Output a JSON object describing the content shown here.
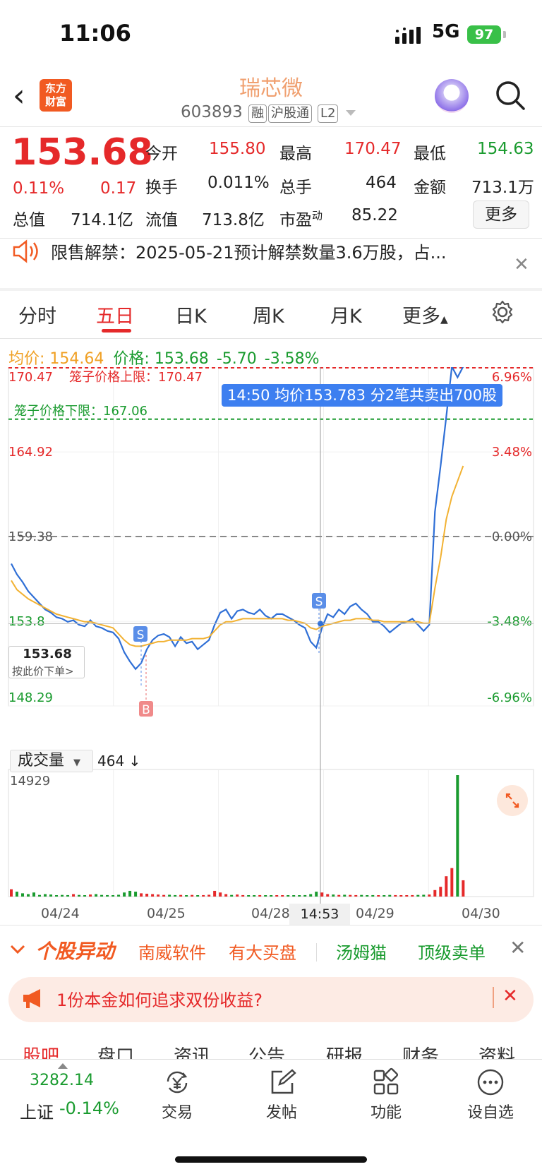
{
  "status_bar": {
    "time": "11:06",
    "network": "5G",
    "battery": "97"
  },
  "header": {
    "logo_line1": "东方",
    "logo_line2": "财富",
    "stock_name": "瑞芯微",
    "stock_code": "603893",
    "tags": [
      "融",
      "沪股通",
      "L2"
    ]
  },
  "quote": {
    "price": "153.68",
    "change_pct": "0.11%",
    "change": "0.17",
    "fields": {
      "open_label": "今开",
      "open": "155.80",
      "high_label": "最高",
      "high": "170.47",
      "low_label": "最低",
      "low": "154.63",
      "turnover_label": "换手",
      "turnover": "0.011%",
      "volume_label": "总手",
      "volume": "464",
      "amount_label": "金额",
      "amount": "713.1万",
      "mcap_label": "总值",
      "mcap": "714.1亿",
      "float_label": "流值",
      "float": "713.8亿",
      "pe_label": "市盈",
      "pe_sup": "动",
      "pe": "85.22"
    },
    "more_label": "更多"
  },
  "notice": {
    "text": "限售解禁：2025-05-21预计解禁数量3.6万股，占..."
  },
  "tabs": [
    {
      "label": "分时",
      "active": false
    },
    {
      "label": "五日",
      "active": true
    },
    {
      "label": "日K",
      "active": false
    },
    {
      "label": "周K",
      "active": false
    },
    {
      "label": "月K",
      "active": false
    },
    {
      "label": "更多",
      "active": false
    }
  ],
  "legend": {
    "avg_label": "均价:",
    "avg_value": "154.64",
    "price_label": "价格:",
    "price_value": "153.68",
    "change": "-5.70",
    "change_pct": "-3.58%"
  },
  "chart_overlay": {
    "upper_limit_text": "笼子价格上限：170.47",
    "lower_limit_text": "笼子价格下限：167.06",
    "bubble": "14:50 均价153.783  分2笔共卖出700股",
    "price_box_value": "153.68",
    "price_box_hint": "按此价下单>",
    "marker_s": "S",
    "marker_b": "B"
  },
  "volume": {
    "selector_label": "成交量",
    "value": "464 ↓",
    "max_label": "14929"
  },
  "crosshair_time": "14:53",
  "chart_data": {
    "type": "line",
    "title": "",
    "x_labels": [
      "04/24",
      "04/25",
      "04/28",
      "04/29",
      "04/30"
    ],
    "y_left_ticks": [
      "170.47",
      "164.92",
      "159.38",
      "153.8",
      "148.29"
    ],
    "y_right_ticks": [
      "6.96%",
      "3.48%",
      "0.00%",
      "-3.48%",
      "-6.96%"
    ],
    "ylim": [
      148.29,
      170.47
    ],
    "prev_close": 159.38,
    "upper_limit": 170.47,
    "lower_limit": 167.06,
    "series": [
      {
        "name": "价格",
        "color": "#2f6fd6",
        "values": [
          157.6,
          156.9,
          156.4,
          155.8,
          155.4,
          155.0,
          154.6,
          154.4,
          154.1,
          154.0,
          153.8,
          153.9,
          153.6,
          153.5,
          153.9,
          153.5,
          153.4,
          153.2,
          153.1,
          152.7,
          151.8,
          151.2,
          150.7,
          151.1,
          152.0,
          152.6,
          152.9,
          153.0,
          152.8,
          152.2,
          152.8,
          152.4,
          152.5,
          152.0,
          152.3,
          152.6,
          153.6,
          154.4,
          154.6,
          154.0,
          154.5,
          154.6,
          154.4,
          154.3,
          154.6,
          154.2,
          154.0,
          154.3,
          154.3,
          154.1,
          153.9,
          153.6,
          153.4,
          152.5,
          152.1,
          153.4,
          154.3,
          154.1,
          154.6,
          154.3,
          154.8,
          155.0,
          154.6,
          154.3,
          153.8,
          153.8,
          153.5,
          153.1,
          153.4,
          153.7,
          153.8,
          154.0,
          153.6,
          153.2,
          153.6,
          161.0,
          164.0,
          167.2,
          170.5,
          169.8,
          170.5
        ]
      },
      {
        "name": "均价",
        "color": "#f2b233",
        "values": [
          156.5,
          155.9,
          155.6,
          155.3,
          155.1,
          154.9,
          154.7,
          154.5,
          154.3,
          154.2,
          154.1,
          154.0,
          153.9,
          153.8,
          153.8,
          153.7,
          153.6,
          153.5,
          153.4,
          153.0,
          152.6,
          152.3,
          152.2,
          152.2,
          152.3,
          152.4,
          152.5,
          152.5,
          152.6,
          152.6,
          152.6,
          152.6,
          152.7,
          152.7,
          152.7,
          152.8,
          153.2,
          153.6,
          153.8,
          153.8,
          153.9,
          154.0,
          154.0,
          154.0,
          154.0,
          154.0,
          154.0,
          154.0,
          154.0,
          153.9,
          153.9,
          153.8,
          153.7,
          153.4,
          153.3,
          153.5,
          153.6,
          153.7,
          153.8,
          153.9,
          153.9,
          154.0,
          154.0,
          154.0,
          153.9,
          153.9,
          153.8,
          153.8,
          153.8,
          153.8,
          153.8,
          153.8,
          153.8,
          153.7,
          153.7,
          156.0,
          158.0,
          160.5,
          162.0,
          163.0,
          164.0
        ]
      }
    ],
    "volume_max": 14929,
    "volume_values": [
      900,
      600,
      400,
      300,
      500,
      200,
      300,
      250,
      150,
      200,
      180,
      300,
      200,
      150,
      250,
      300,
      200,
      180,
      150,
      220,
      500,
      700,
      600,
      400,
      350,
      300,
      250,
      200,
      220,
      180,
      200,
      150,
      200,
      160,
      180,
      220,
      700,
      500,
      300,
      200,
      250,
      180,
      160,
      150,
      180,
      140,
      160,
      150,
      170,
      140,
      160,
      150,
      180,
      300,
      600,
      500,
      300,
      250,
      200,
      220,
      200,
      180,
      200,
      160,
      180,
      160,
      150,
      200,
      180,
      160,
      170,
      180,
      200,
      220,
      250,
      800,
      1200,
      2500,
      3500,
      14929,
      2000
    ]
  },
  "movers": {
    "title": "个股异动",
    "items": [
      "南威软件",
      "有大买盘",
      "汤姆猫",
      "顶级卖单"
    ]
  },
  "ad": {
    "text": "1份本金如何追求双份收益?"
  },
  "subtabs": [
    "股吧",
    "盘口",
    "资讯",
    "公告",
    "研报",
    "财务",
    "资料"
  ],
  "bottom_bar": {
    "index_value": "3282.14",
    "index_name": "上证",
    "index_change": "-0.14%",
    "items": [
      "交易",
      "发帖",
      "功能",
      "设自选"
    ]
  },
  "colors": {
    "up": "#e5292a",
    "down": "#1a9b2f",
    "price_line": "#2f6fd6",
    "avg_line": "#f2b233",
    "brand": "#f15a22"
  }
}
